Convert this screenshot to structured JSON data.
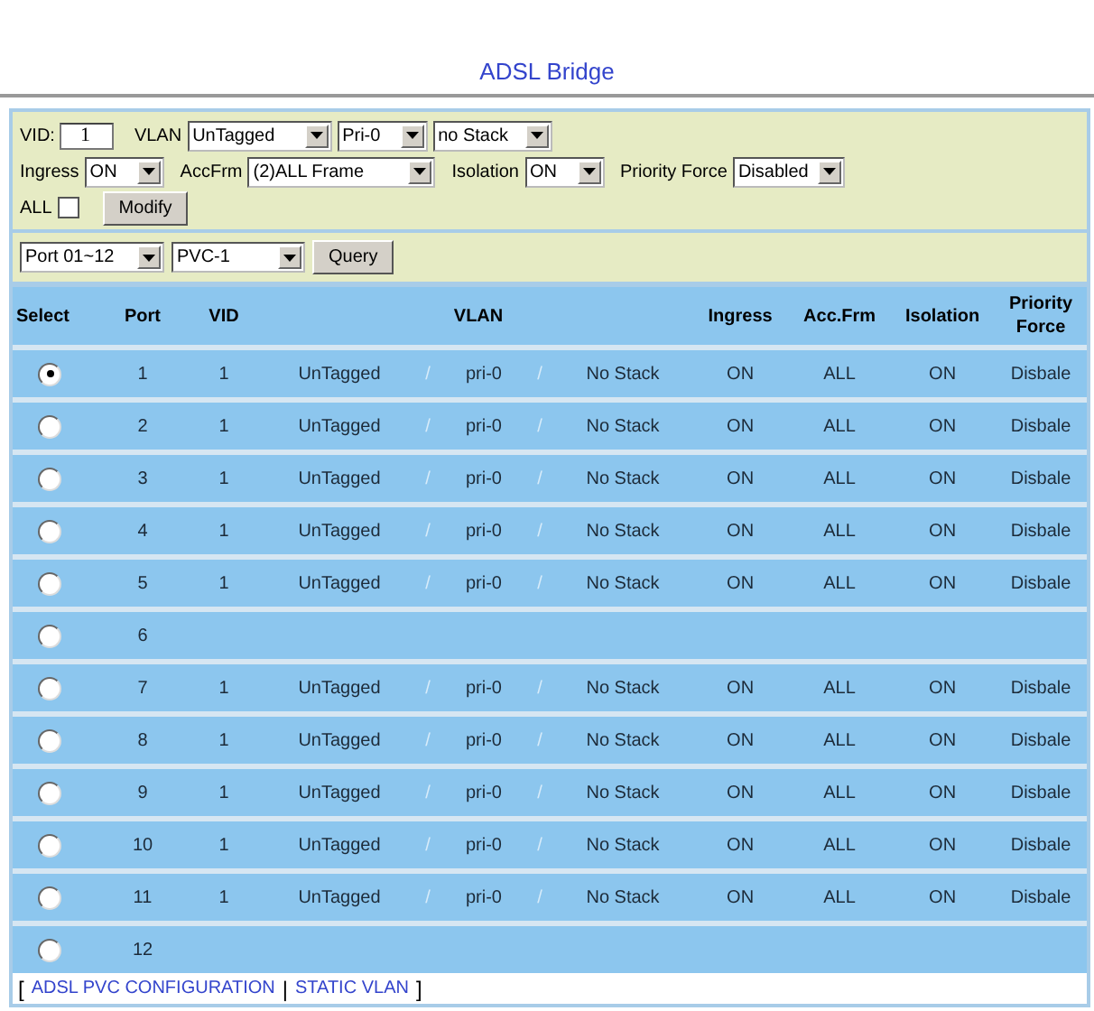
{
  "title": "ADSL Bridge",
  "form": {
    "vid_label": "VID:",
    "vid_value": "1",
    "vlan_label": "VLAN",
    "vlan_mode": "UnTagged",
    "priority": "Pri-0",
    "stack": "no Stack",
    "ingress_label": "Ingress",
    "ingress": "ON",
    "accfrm_label": "AccFrm",
    "accfrm": "(2)ALL Frame",
    "isolation_label": "Isolation",
    "isolation": "ON",
    "priority_force_label": "Priority Force",
    "priority_force": "Disabled",
    "all_label": "ALL",
    "all_checked": false,
    "modify_button": "Modify"
  },
  "query": {
    "port_range": "Port 01~12",
    "pvc": "PVC-1",
    "button": "Query"
  },
  "table": {
    "columns": [
      "Select",
      "Port",
      "VID",
      "VLAN",
      "Ingress",
      "Acc.Frm",
      "Isolation",
      "Priority Force"
    ],
    "rows": [
      {
        "selected": true,
        "port": "1",
        "vid": "1",
        "vlan": "UnTagged",
        "sep1": "/",
        "priority": "pri-0",
        "sep2": "/",
        "stack": "No Stack",
        "ingress": "ON",
        "acc_frm": "ALL",
        "isolation": "ON",
        "priority_force": "Disbale"
      },
      {
        "selected": false,
        "port": "2",
        "vid": "1",
        "vlan": "UnTagged",
        "sep1": "/",
        "priority": "pri-0",
        "sep2": "/",
        "stack": "No Stack",
        "ingress": "ON",
        "acc_frm": "ALL",
        "isolation": "ON",
        "priority_force": "Disbale"
      },
      {
        "selected": false,
        "port": "3",
        "vid": "1",
        "vlan": "UnTagged",
        "sep1": "/",
        "priority": "pri-0",
        "sep2": "/",
        "stack": "No Stack",
        "ingress": "ON",
        "acc_frm": "ALL",
        "isolation": "ON",
        "priority_force": "Disbale"
      },
      {
        "selected": false,
        "port": "4",
        "vid": "1",
        "vlan": "UnTagged",
        "sep1": "/",
        "priority": "pri-0",
        "sep2": "/",
        "stack": "No Stack",
        "ingress": "ON",
        "acc_frm": "ALL",
        "isolation": "ON",
        "priority_force": "Disbale"
      },
      {
        "selected": false,
        "port": "5",
        "vid": "1",
        "vlan": "UnTagged",
        "sep1": "/",
        "priority": "pri-0",
        "sep2": "/",
        "stack": "No Stack",
        "ingress": "ON",
        "acc_frm": "ALL",
        "isolation": "ON",
        "priority_force": "Disbale"
      },
      {
        "selected": false,
        "port": "6"
      },
      {
        "selected": false,
        "port": "7",
        "vid": "1",
        "vlan": "UnTagged",
        "sep1": "/",
        "priority": "pri-0",
        "sep2": "/",
        "stack": "No Stack",
        "ingress": "ON",
        "acc_frm": "ALL",
        "isolation": "ON",
        "priority_force": "Disbale"
      },
      {
        "selected": false,
        "port": "8",
        "vid": "1",
        "vlan": "UnTagged",
        "sep1": "/",
        "priority": "pri-0",
        "sep2": "/",
        "stack": "No Stack",
        "ingress": "ON",
        "acc_frm": "ALL",
        "isolation": "ON",
        "priority_force": "Disbale"
      },
      {
        "selected": false,
        "port": "9",
        "vid": "1",
        "vlan": "UnTagged",
        "sep1": "/",
        "priority": "pri-0",
        "sep2": "/",
        "stack": "No Stack",
        "ingress": "ON",
        "acc_frm": "ALL",
        "isolation": "ON",
        "priority_force": "Disbale"
      },
      {
        "selected": false,
        "port": "10",
        "vid": "1",
        "vlan": "UnTagged",
        "sep1": "/",
        "priority": "pri-0",
        "sep2": "/",
        "stack": "No Stack",
        "ingress": "ON",
        "acc_frm": "ALL",
        "isolation": "ON",
        "priority_force": "Disbale"
      },
      {
        "selected": false,
        "port": "11",
        "vid": "1",
        "vlan": "UnTagged",
        "sep1": "/",
        "priority": "pri-0",
        "sep2": "/",
        "stack": "No Stack",
        "ingress": "ON",
        "acc_frm": "ALL",
        "isolation": "ON",
        "priority_force": "Disbale"
      },
      {
        "selected": false,
        "port": "12"
      }
    ]
  },
  "footer": {
    "open": "[",
    "links": [
      "ADSL PVC CONFIGURATION",
      "STATIC VLAN"
    ],
    "divider": "|",
    "close": "]"
  }
}
